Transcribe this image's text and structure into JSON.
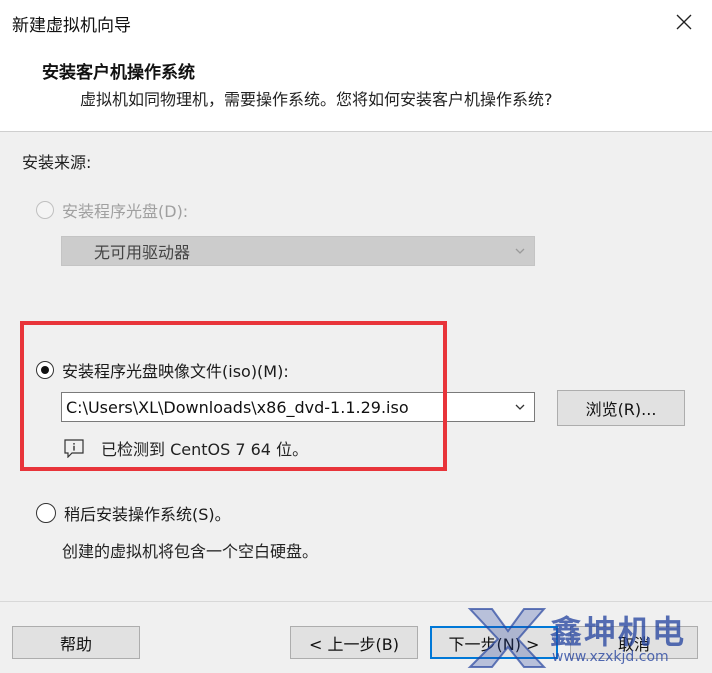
{
  "window": {
    "title": "新建虚拟机向导"
  },
  "header": {
    "title": "安装客户机操作系统",
    "subtitle": "虚拟机如同物理机，需要操作系统。您将如何安装客户机操作系统?"
  },
  "source": {
    "label": "安装来源:",
    "disc": {
      "label": "安装程序光盘(D):",
      "selected": false,
      "enabled": false,
      "drive_value": "无可用驱动器"
    },
    "iso": {
      "label": "安装程序光盘映像文件(iso)(M):",
      "selected": true,
      "path_value": "C:\\Users\\XL\\Downloads\\x86_dvd-1.1.29.iso",
      "browse_label": "浏览(R)...",
      "detected_text": "已检测到 CentOS 7 64 位。"
    },
    "later": {
      "label": "稍后安装操作系统(S)。",
      "selected": false,
      "description": "创建的虚拟机将包含一个空白硬盘。"
    }
  },
  "footer": {
    "help_label": "帮助",
    "back_label": "< 上一步(B)",
    "next_label": "下一步(N) >",
    "cancel_label": "取消"
  },
  "watermark": {
    "text": "鑫坤机电",
    "url": "www.xzxkjd.com"
  },
  "colors": {
    "highlight": "#e8343a",
    "primary_border": "#0078d7",
    "watermark": "#2846a0"
  }
}
